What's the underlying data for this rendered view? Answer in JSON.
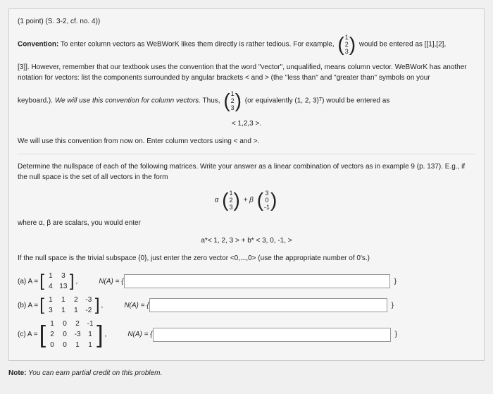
{
  "header": "(1 point) (S. 3-2, cf. no. 4))",
  "conv_label": "Convention:",
  "conv1": " To enter column vectors as WeBWorK likes them directly is rather tedious. For example, ",
  "conv2": " would be entered as [[1],[2],",
  "conv3": "[3]]. However, remember that our textbook uses the convention that the word \"vector\", unqualified, means column vector. WeBWorK has another notation for vectors: list the components surrounded by angular brackets < and > (the \"less than\" and \"greater than\" symbols on your",
  "conv4": "keyboard.). ",
  "conv4i": "We will use this convention for column vectors.",
  "conv4b": " Thus, ",
  "conv5": " (or equivalently (1, 2, 3)ᵀ) would be entered as",
  "conv6": "< 1,2,3 >.",
  "conv7": "We will use this convention from now on. Enter column vectors using < and >.",
  "det1": "Determine the nullspace of each of the following matrices. Write your answer as a linear combination of vectors as in example 9 (p. 137). E.g., if the null space is the set of all vectors in the form",
  "det2": "where α, β are scalars, you would enter",
  "det3": "a*< 1, 2, 3 > + b* < 3, 0, -1, >",
  "det4": "If the null space is the trivial subspace {0}, just enter the zero vector <0,...,0> (use the appropriate number of 0's.)",
  "a_label": "(a) A = ",
  "b_label": "(b) A = ",
  "c_label": "(c) A = ",
  "na_label": "N(A) = {",
  "brace": "}",
  "comma": ",",
  "note_label": "Note:",
  "note": " You can earn partial credit on this problem.",
  "v": {
    "1": "1",
    "2": "2",
    "3": "3",
    "m1": "-1",
    "m2": "-2",
    "m3": "-3",
    "0": "0",
    "4": "4",
    "13": "13"
  },
  "alpha": "α",
  "beta": "+ β",
  "plus": "+"
}
